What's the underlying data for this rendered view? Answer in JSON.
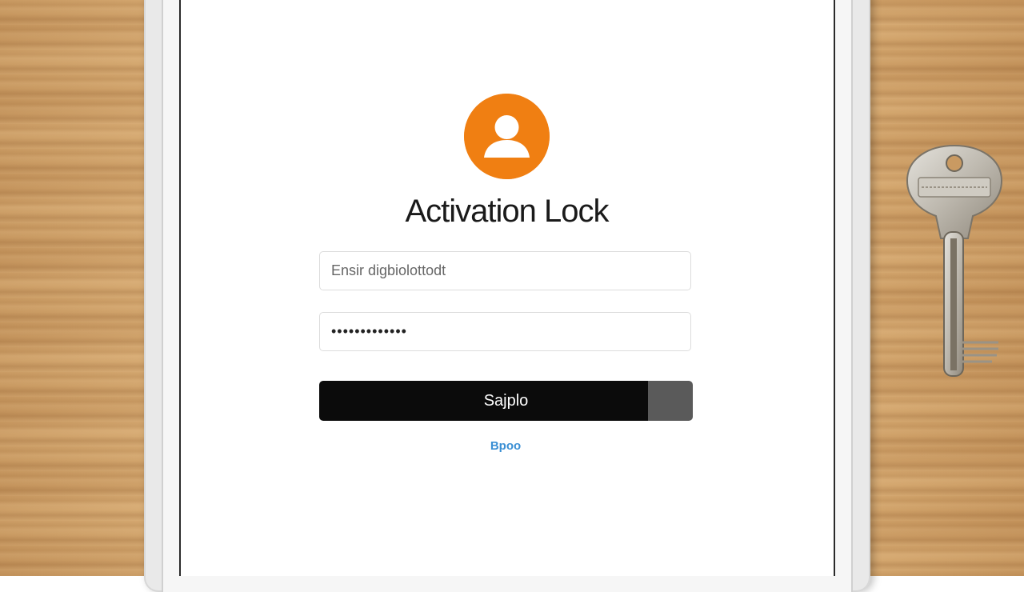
{
  "screen": {
    "title": "Activation Lock",
    "username_field": {
      "placeholder": "Ensir digbiolottodt",
      "value": ""
    },
    "password_field": {
      "value": "•••••••••••••"
    },
    "submit_label": "Sajplo",
    "help_link_label": "Bpoo"
  },
  "icons": {
    "avatar": "person-icon",
    "key": "key-icon"
  },
  "colors": {
    "avatar_bg": "#f07f12",
    "button_bg": "#0b0b0b",
    "link": "#3a8fd4"
  }
}
